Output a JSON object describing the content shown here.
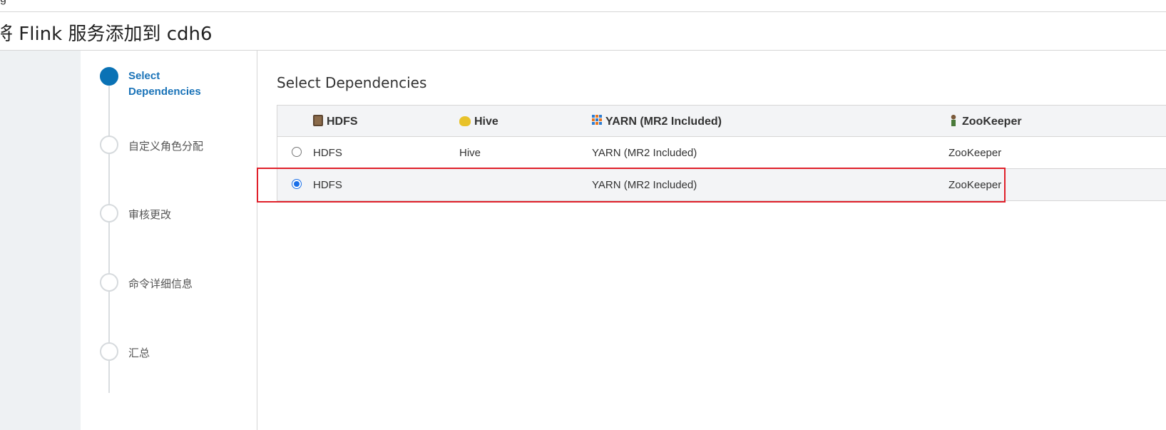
{
  "window": {
    "top_cut_text": "g",
    "title": "将 Flink 服务添加到 cdh6"
  },
  "wizard": {
    "steps": [
      {
        "label": "Select Dependencies",
        "active": true
      },
      {
        "label": "自定义角色分配",
        "active": false
      },
      {
        "label": "审核更改",
        "active": false
      },
      {
        "label": "命令详细信息",
        "active": false
      },
      {
        "label": "汇总",
        "active": false
      }
    ]
  },
  "main": {
    "section_title": "Select Dependencies",
    "table": {
      "headers": [
        {
          "label": "HDFS",
          "icon": "hdfs-icon"
        },
        {
          "label": "Hive",
          "icon": "hive-icon"
        },
        {
          "label": "YARN (MR2 Included)",
          "icon": "yarn-icon"
        },
        {
          "label": "ZooKeeper",
          "icon": "zookeeper-icon"
        }
      ],
      "rows": [
        {
          "selected": false,
          "hdfs": "HDFS",
          "hive": "Hive",
          "yarn": "YARN (MR2 Included)",
          "zookeeper": "ZooKeeper"
        },
        {
          "selected": true,
          "hdfs": "HDFS",
          "hive": "",
          "yarn": "YARN (MR2 Included)",
          "zookeeper": "ZooKeeper"
        }
      ]
    }
  },
  "colors": {
    "accent": "#0a72b5",
    "highlight": "#e0202a",
    "gutter": "#eef1f3"
  }
}
